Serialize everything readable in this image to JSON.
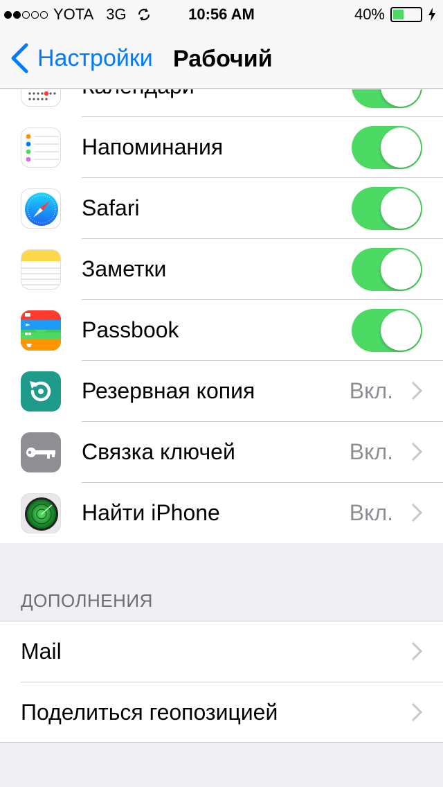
{
  "status_bar": {
    "carrier": "YOTA",
    "network": "3G",
    "time": "10:56 AM",
    "battery_percent": "40%",
    "battery_level": 0.4,
    "signal_bars_filled": 2,
    "signal_bars_total": 5
  },
  "nav": {
    "back_label": "Настройки",
    "title": "Рабочий"
  },
  "rows": [
    {
      "label": "Календари",
      "icon": "calendar-icon",
      "control": "toggle",
      "on": true
    },
    {
      "label": "Напоминания",
      "icon": "reminders-icon",
      "control": "toggle",
      "on": true
    },
    {
      "label": "Safari",
      "icon": "safari-icon",
      "control": "toggle",
      "on": true
    },
    {
      "label": "Заметки",
      "icon": "notes-icon",
      "control": "toggle",
      "on": true
    },
    {
      "label": "Passbook",
      "icon": "passbook-icon",
      "control": "toggle",
      "on": true
    },
    {
      "label": "Резервная копия",
      "icon": "backup-icon",
      "control": "value",
      "value": "Вкл."
    },
    {
      "label": "Связка ключей",
      "icon": "keychain-icon",
      "control": "value",
      "value": "Вкл."
    },
    {
      "label": "Найти iPhone",
      "icon": "find-iphone-icon",
      "control": "value",
      "value": "Вкл."
    }
  ],
  "extras": {
    "header": "ДОПОЛНЕНИЯ",
    "items": [
      {
        "label": "Mail"
      },
      {
        "label": "Поделиться геопозицией"
      }
    ]
  },
  "colors": {
    "accent": "#007aff",
    "toggle_on": "#4cd964",
    "separator": "#c8c7cc",
    "secondary_text": "#8e8e93"
  }
}
